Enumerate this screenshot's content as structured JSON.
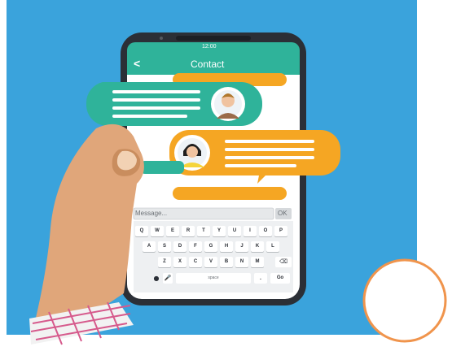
{
  "phone": {
    "status_time": "12:00",
    "header_title": "Contact",
    "back_label": "<"
  },
  "input": {
    "placeholder": "Message...",
    "ok_label": "OK"
  },
  "keyboard": {
    "row1": [
      "Q",
      "W",
      "E",
      "R",
      "T",
      "Y",
      "U",
      "I",
      "O",
      "P"
    ],
    "row2": [
      "A",
      "S",
      "D",
      "F",
      "G",
      "H",
      "J",
      "K",
      "L"
    ],
    "row3": [
      "Z",
      "X",
      "C",
      "V",
      "B",
      "N",
      "M"
    ],
    "space_label": "space",
    "go_label": "Go"
  },
  "colors": {
    "background": "#3aa3dc",
    "teal": "#2fb39a",
    "orange": "#f5a623",
    "phone_body": "#2b2f36",
    "skin": "#e0a67a",
    "circle_outline": "#f0944c"
  },
  "icons": [
    "back-arrow-icon",
    "male-avatar-icon",
    "female-avatar-icon",
    "backspace-icon",
    "globe-icon",
    "microphone-icon"
  ]
}
